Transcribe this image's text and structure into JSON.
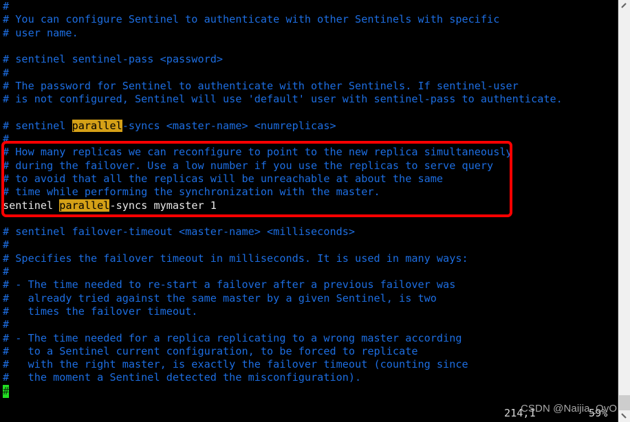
{
  "editor": {
    "app": "vim",
    "file_type": "redis-sentinel-config",
    "background_color": "#000000",
    "comment_color": "#1d6ee2",
    "code_color": "#e8e8e8",
    "search_highlight_color": "#d4a017",
    "search_term": "parallel",
    "cursor_color": "#22dd22",
    "cursor_char": "#",
    "lines": [
      {
        "text": "#",
        "type": "comment"
      },
      {
        "text": "# You can configure Sentinel to authenticate with other Sentinels with specific",
        "type": "comment"
      },
      {
        "text": "# user name.",
        "type": "comment"
      },
      {
        "text": "",
        "type": "blank"
      },
      {
        "text": "# sentinel sentinel-pass <password>",
        "type": "comment"
      },
      {
        "text": "#",
        "type": "comment"
      },
      {
        "text": "# The password for Sentinel to authenticate with other Sentinels. If sentinel-user",
        "type": "comment"
      },
      {
        "text": "# is not configured, Sentinel will use 'default' user with sentinel-pass to authenticate.",
        "type": "comment"
      },
      {
        "text": "",
        "type": "blank"
      },
      {
        "text": "# sentinel parallel-syncs <master-name> <numreplicas>",
        "type": "comment",
        "highlight": "parallel"
      },
      {
        "text": "#",
        "type": "comment"
      },
      {
        "text": "# How many replicas we can reconfigure to point to the new replica simultaneously",
        "type": "comment"
      },
      {
        "text": "# during the failover. Use a low number if you use the replicas to serve query",
        "type": "comment"
      },
      {
        "text": "# to avoid that all the replicas will be unreachable at about the same",
        "type": "comment"
      },
      {
        "text": "# time while performing the synchronization with the master.",
        "type": "comment"
      },
      {
        "text": "sentinel parallel-syncs mymaster 1",
        "type": "code",
        "highlight": "parallel"
      },
      {
        "text": "",
        "type": "blank"
      },
      {
        "text": "# sentinel failover-timeout <master-name> <milliseconds>",
        "type": "comment"
      },
      {
        "text": "#",
        "type": "comment"
      },
      {
        "text": "# Specifies the failover timeout in milliseconds. It is used in many ways:",
        "type": "comment"
      },
      {
        "text": "#",
        "type": "comment"
      },
      {
        "text": "# - The time needed to re-start a failover after a previous failover was",
        "type": "comment"
      },
      {
        "text": "#   already tried against the same master by a given Sentinel, is two",
        "type": "comment"
      },
      {
        "text": "#   times the failover timeout.",
        "type": "comment"
      },
      {
        "text": "#",
        "type": "comment"
      },
      {
        "text": "# - The time needed for a replica replicating to a wrong master according",
        "type": "comment"
      },
      {
        "text": "#   to a Sentinel current configuration, to be forced to replicate",
        "type": "comment"
      },
      {
        "text": "#   with the right master, is exactly the failover timeout (counting since",
        "type": "comment"
      },
      {
        "text": "#   the moment a Sentinel detected the misconfiguration).",
        "type": "comment"
      },
      {
        "text": "#",
        "type": "cursor"
      }
    ]
  },
  "annotation": {
    "shape": "rounded-rectangle",
    "color": "#fe0000",
    "covers_lines": [
      "# How many replicas we can reconfigure to point to the new replica simultaneously",
      "# during the failover. Use a low number if you use the replicas to serve query",
      "# to avoid that all the replicas will be unreachable at about the same",
      "# time while performing the synchronization with the master.",
      "sentinel parallel-syncs mymaster 1"
    ]
  },
  "status_bar": {
    "position": "214,1",
    "percent": "59%"
  },
  "watermark": {
    "text": "CSDN @Naijia_OvO"
  },
  "scrollbar": {
    "up_arrow": "scroll-up-arrow",
    "down_arrow": "scroll-down-arrow",
    "thumb_position_percent": 94
  }
}
